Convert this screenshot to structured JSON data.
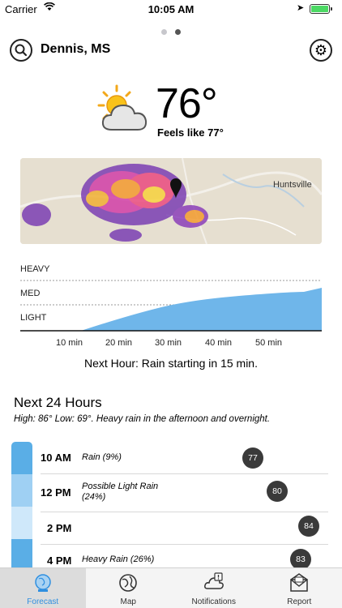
{
  "status_bar": {
    "carrier": "Carrier",
    "time": "10:05 AM"
  },
  "header": {
    "location": "Dennis, MS"
  },
  "current": {
    "temperature": "76°",
    "feels_like": "Feels like 77°",
    "icon": "partly-cloudy-icon"
  },
  "map": {
    "city_label": "Huntsville"
  },
  "precip_graph": {
    "levels": [
      "HEAVY",
      "MED",
      "LIGHT"
    ],
    "time_labels": [
      "10 min",
      "20 min",
      "30 min",
      "40 min",
      "50 min"
    ],
    "summary": "Next Hour: Rain starting in 15 min."
  },
  "next24": {
    "title": "Next 24 Hours",
    "summary": "High: 86° Low: 69°. Heavy rain in the afternoon and overnight.",
    "hours": [
      {
        "time": "10 AM",
        "desc": "Rain (9%)",
        "temp": "77"
      },
      {
        "time": "12 PM",
        "desc": "Possible Light Rain (24%)",
        "temp": "80"
      },
      {
        "time": "2 PM",
        "desc": "",
        "temp": "84"
      },
      {
        "time": "4 PM",
        "desc": "Heavy Rain (26%)",
        "temp": "83"
      }
    ]
  },
  "tabs": [
    {
      "label": "Forecast",
      "icon": "globe-icon",
      "active": true
    },
    {
      "label": "Map",
      "icon": "map-globe-icon",
      "active": false
    },
    {
      "label": "Notifications",
      "icon": "notification-cloud-icon",
      "active": false
    },
    {
      "label": "Report",
      "icon": "envelope-icon",
      "active": false
    }
  ],
  "colors": {
    "accent": "#2f8fe0",
    "graph_fill": "#6fb6ea",
    "bubble": "#3a3a3a"
  }
}
